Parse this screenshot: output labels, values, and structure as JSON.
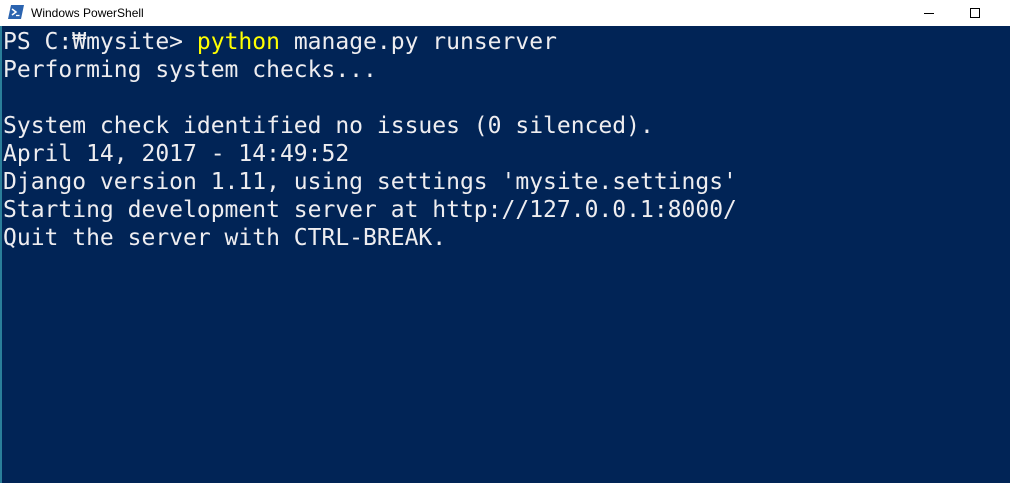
{
  "window": {
    "title": "Windows PowerShell",
    "app_icon": "powershell-icon",
    "controls": {
      "minimize_icon": "minimize-icon",
      "maximize_icon": "maximize-icon"
    }
  },
  "colors": {
    "console_background": "#012456",
    "console_text": "#eeedf0",
    "command_highlight": "#ffff00",
    "titlebar_background": "#ffffff"
  },
  "console": {
    "prompt_line": {
      "prompt": "PS C:₩mysite> ",
      "command": "python",
      "arguments": " manage.py runserver"
    },
    "output_lines": [
      "Performing system checks...",
      "",
      "System check identified no issues (0 silenced).",
      "April 14, 2017 - 14:49:52",
      "Django version 1.11, using settings 'mysite.settings'",
      "Starting development server at http://127.0.0.1:8000/",
      "Quit the server with CTRL-BREAK."
    ]
  }
}
